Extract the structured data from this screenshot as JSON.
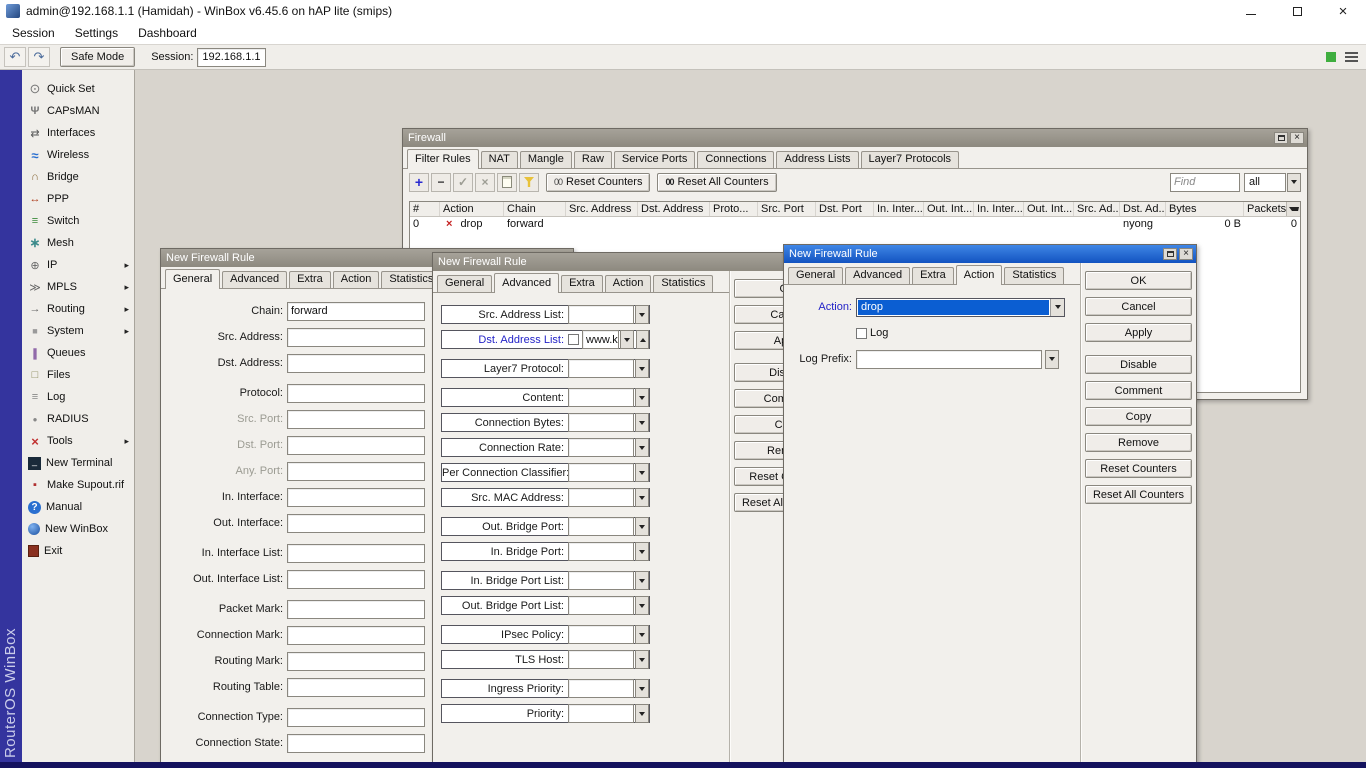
{
  "colors": {
    "titlebar_active_top": "#3f86e6",
    "titlebar_active_bottom": "#1253c0",
    "selection": "#0b5ed2",
    "label_blue": "#2323c8",
    "drop_red": "#c42020",
    "indicator_green": "#3fae3f",
    "brand_strip": "#34349e"
  },
  "app": {
    "title": "admin@192.168.1.1 (Hamidah) - WinBox v6.45.6 on hAP lite (smips)",
    "menu": [
      {
        "label": "Session"
      },
      {
        "label": "Settings"
      },
      {
        "label": "Dashboard"
      }
    ],
    "toolbar": {
      "safe_mode": "Safe Mode",
      "session_label": "Session:",
      "session_value": "192.168.1.1"
    },
    "brand_vertical": "RouterOS WinBox"
  },
  "sidebar": {
    "items": [
      {
        "label": "Quick Set",
        "icon": "quickset-icon",
        "arrow": ""
      },
      {
        "label": "CAPsMAN",
        "icon": "capsman-icon",
        "arrow": ""
      },
      {
        "label": "Interfaces",
        "icon": "interfaces-icon",
        "arrow": ""
      },
      {
        "label": "Wireless",
        "icon": "wireless-icon",
        "arrow": ""
      },
      {
        "label": "Bridge",
        "icon": "bridge-icon",
        "arrow": ""
      },
      {
        "label": "PPP",
        "icon": "ppp-icon",
        "arrow": ""
      },
      {
        "label": "Switch",
        "icon": "switch-icon",
        "arrow": ""
      },
      {
        "label": "Mesh",
        "icon": "mesh-icon",
        "arrow": ""
      },
      {
        "label": "IP",
        "icon": "ip-icon",
        "arrow": "▸"
      },
      {
        "label": "MPLS",
        "icon": "mpls-icon",
        "arrow": "▸"
      },
      {
        "label": "Routing",
        "icon": "routing-icon",
        "arrow": "▸"
      },
      {
        "label": "System",
        "icon": "system-icon",
        "arrow": "▸"
      },
      {
        "label": "Queues",
        "icon": "queues-icon",
        "arrow": ""
      },
      {
        "label": "Files",
        "icon": "files-icon",
        "arrow": ""
      },
      {
        "label": "Log",
        "icon": "log-icon",
        "arrow": ""
      },
      {
        "label": "RADIUS",
        "icon": "radius-icon",
        "arrow": ""
      },
      {
        "label": "Tools",
        "icon": "tools-icon",
        "arrow": "▸"
      },
      {
        "label": "New Terminal",
        "icon": "terminal-icon",
        "arrow": ""
      },
      {
        "label": "Make Supout.rif",
        "icon": "supout-icon",
        "arrow": ""
      },
      {
        "label": "Manual",
        "icon": "manual-icon",
        "arrow": ""
      },
      {
        "label": "New WinBox",
        "icon": "newwinbox-icon",
        "arrow": ""
      },
      {
        "label": "Exit",
        "icon": "exit-icon",
        "arrow": ""
      }
    ]
  },
  "firewall": {
    "title": "Firewall",
    "tabs": [
      {
        "label": "Filter Rules",
        "cls": "active"
      },
      {
        "label": "NAT",
        "cls": ""
      },
      {
        "label": "Mangle",
        "cls": ""
      },
      {
        "label": "Raw",
        "cls": ""
      },
      {
        "label": "Service Ports",
        "cls": ""
      },
      {
        "label": "Connections",
        "cls": ""
      },
      {
        "label": "Address Lists",
        "cls": ""
      },
      {
        "label": "Layer7 Protocols",
        "cls": ""
      }
    ],
    "toolbar": {
      "icons": [
        {
          "icon": "add-icon",
          "glyph": "+",
          "cls": "add"
        },
        {
          "icon": "remove-icon",
          "glyph": "−",
          "cls": "rem"
        },
        {
          "icon": "enable-icon",
          "glyph": "✓",
          "cls": "dim"
        },
        {
          "icon": "disable-icon",
          "glyph": "×",
          "cls": "dim"
        },
        {
          "icon": "comment-icon",
          "glyph": "",
          "cls": "shape"
        },
        {
          "icon": "filter-icon",
          "glyph": "",
          "cls": "shape"
        }
      ],
      "counters_badge": "00",
      "reset_counters": "Reset Counters",
      "reset_all_counters": "Reset All Counters",
      "find_placeholder": "Find",
      "filter_all": "all"
    },
    "columns": [
      {
        "label": "#"
      },
      {
        "label": "Action"
      },
      {
        "label": "Chain"
      },
      {
        "label": "Src. Address"
      },
      {
        "label": "Dst. Address"
      },
      {
        "label": "Proto..."
      },
      {
        "label": "Src. Port"
      },
      {
        "label": "Dst. Port"
      },
      {
        "label": "In. Inter..."
      },
      {
        "label": "Out. Int..."
      },
      {
        "label": "In. Inter..."
      },
      {
        "label": "Out. Int..."
      },
      {
        "label": "Src. Ad..."
      },
      {
        "label": "Dst. Ad..."
      },
      {
        "label": "Bytes"
      },
      {
        "label": "Packets"
      }
    ],
    "rule": {
      "num": "0",
      "action": "drop",
      "chain": "forward",
      "dst_address_list": "nyong",
      "bytes": "0 B",
      "packets": "0"
    }
  },
  "dialog_buttons": [
    {
      "label": "OK",
      "cls": ""
    },
    {
      "label": "Cancel",
      "cls": ""
    },
    {
      "label": "Apply",
      "cls": ""
    },
    {
      "label": "Disable",
      "cls": "gap"
    },
    {
      "label": "Comment",
      "cls": ""
    },
    {
      "label": "Copy",
      "cls": ""
    },
    {
      "label": "Remove",
      "cls": ""
    },
    {
      "label": "Reset Counters",
      "cls": ""
    },
    {
      "label": "Reset All Counters",
      "cls": ""
    }
  ],
  "dialog_general": {
    "title": "New Firewall Rule",
    "tabs": [
      {
        "label": "General",
        "cls": "active"
      },
      {
        "label": "Advanced",
        "cls": ""
      },
      {
        "label": "Extra",
        "cls": ""
      },
      {
        "label": "Action",
        "cls": ""
      },
      {
        "label": "Statistics",
        "cls": ""
      }
    ],
    "fields": [
      {
        "label": "Chain:",
        "value": "forward",
        "cls": ""
      },
      {
        "label": "Src. Address:",
        "value": "",
        "cls": ""
      },
      {
        "label": "Dst. Address:",
        "value": "",
        "cls": ""
      },
      {
        "label": "Protocol:",
        "value": "",
        "cls": "gap"
      },
      {
        "label": "Src. Port:",
        "value": "",
        "cls": "dis"
      },
      {
        "label": "Dst. Port:",
        "value": "",
        "cls": "dis"
      },
      {
        "label": "Any. Port:",
        "value": "",
        "cls": "dis"
      },
      {
        "label": "In. Interface:",
        "value": "",
        "cls": ""
      },
      {
        "label": "Out. Interface:",
        "value": "",
        "cls": ""
      },
      {
        "label": "In. Interface List:",
        "value": "",
        "cls": "gap"
      },
      {
        "label": "Out. Interface List:",
        "value": "",
        "cls": ""
      },
      {
        "label": "Packet Mark:",
        "value": "",
        "cls": "gap"
      },
      {
        "label": "Connection Mark:",
        "value": "",
        "cls": ""
      },
      {
        "label": "Routing Mark:",
        "value": "",
        "cls": ""
      },
      {
        "label": "Routing Table:",
        "value": "",
        "cls": ""
      },
      {
        "label": "Connection Type:",
        "value": "",
        "cls": "gap"
      },
      {
        "label": "Connection State:",
        "value": "",
        "cls": ""
      }
    ]
  },
  "dialog_advanced": {
    "title": "New Firewall Rule",
    "tabs": [
      {
        "label": "General",
        "cls": ""
      },
      {
        "label": "Advanced",
        "cls": "active"
      },
      {
        "label": "Extra",
        "cls": ""
      },
      {
        "label": "Action",
        "cls": ""
      },
      {
        "label": "Statistics",
        "cls": ""
      }
    ],
    "fields": [
      {
        "label": "Src. Address List:",
        "value": "",
        "cls": "combo"
      },
      {
        "label": "Dst. Address List:",
        "value": "www.kaskus.com",
        "cls": "combo blue check up"
      },
      {
        "label": "Layer7 Protocol:",
        "value": "",
        "cls": "combo gap"
      },
      {
        "label": "Content:",
        "value": "",
        "cls": "combo gap"
      },
      {
        "label": "Connection Bytes:",
        "value": "",
        "cls": "combo"
      },
      {
        "label": "Connection Rate:",
        "value": "",
        "cls": "combo"
      },
      {
        "label": "Per Connection Classifier:",
        "value": "",
        "cls": "combo"
      },
      {
        "label": "Src. MAC Address:",
        "value": "",
        "cls": "combo"
      },
      {
        "label": "Out. Bridge Port:",
        "value": "",
        "cls": "combo gap"
      },
      {
        "label": "In. Bridge Port:",
        "value": "",
        "cls": "combo"
      },
      {
        "label": "In. Bridge Port List:",
        "value": "",
        "cls": "combo gap"
      },
      {
        "label": "Out. Bridge Port List:",
        "value": "",
        "cls": "combo"
      },
      {
        "label": "IPsec Policy:",
        "value": "",
        "cls": "combo gap"
      },
      {
        "label": "TLS Host:",
        "value": "",
        "cls": "combo"
      },
      {
        "label": "Ingress Priority:",
        "value": "",
        "cls": "combo gap"
      },
      {
        "label": "Priority:",
        "value": "",
        "cls": "combo"
      }
    ]
  },
  "dialog_action": {
    "title": "New Firewall Rule",
    "tabs": [
      {
        "label": "General",
        "cls": ""
      },
      {
        "label": "Advanced",
        "cls": ""
      },
      {
        "label": "Extra",
        "cls": ""
      },
      {
        "label": "Action",
        "cls": "active"
      },
      {
        "label": "Statistics",
        "cls": ""
      }
    ],
    "action_label": "Action:",
    "action_value": "drop",
    "log_label": "Log",
    "log_prefix_label": "Log Prefix:"
  }
}
